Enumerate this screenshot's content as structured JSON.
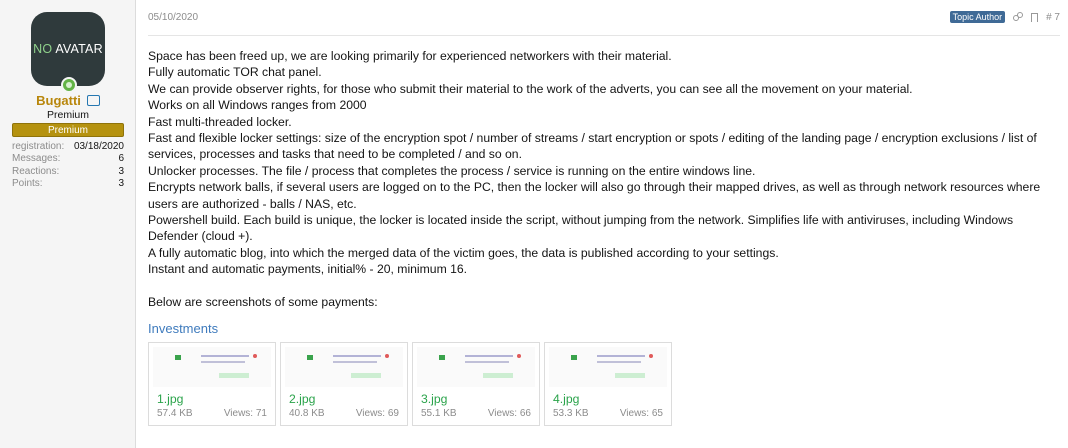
{
  "user": {
    "avatar_text": "NO AVATAR",
    "avatar_prefix": "NO",
    "avatar_suffix": "AVATAR",
    "name": "Bugatti",
    "title": "Premium",
    "banner": "Premium",
    "stats": [
      {
        "label": "registration:",
        "value": "03/18/2020"
      },
      {
        "label": "Messages:",
        "value": "6"
      },
      {
        "label": "Reactions:",
        "value": "3"
      },
      {
        "label": "Points:",
        "value": "3"
      }
    ]
  },
  "post": {
    "date": "05/10/2020",
    "author_badge": "Topic Author",
    "number": "# 7",
    "lines": [
      "Space has been freed up, we are looking primarily for experienced networkers with their material.",
      "Fully automatic TOR chat panel.",
      "We can provide observer rights, for those who submit their material to the work of the adverts, you can see all the movement on your material.",
      "Works on all Windows ranges from 2000",
      "Fast multi-threaded locker.",
      "Fast and flexible locker settings: size of the encryption spot / number of streams / start encryption or spots / editing of the landing page / encryption exclusions / list of services, processes and tasks that need to be completed / and so on.",
      "Unlocker processes. The file / process that completes the process / service is running on the entire windows line.",
      "Encrypts network balls, if several users are logged on to the PC, then the locker will also go through their mapped drives, as well as through network resources where users are authorized - balls / NAS, etc.",
      "Powershell build. Each build is unique, the locker is located inside the script, without jumping from the network. Simplifies life with antiviruses, including Windows Defender (cloud +).",
      "A fully automatic blog, into which the merged data of the victim goes, the data is published according to your settings.",
      "Instant and automatic payments, initial% - 20, minimum 16."
    ],
    "closing": "Below are screenshots of some payments:",
    "attachments_heading": "Investments",
    "attachments": [
      {
        "name": "1.jpg",
        "size": "57.4 KB",
        "views": "Views: 71"
      },
      {
        "name": "2.jpg",
        "size": "40.8 KB",
        "views": "Views: 69"
      },
      {
        "name": "3.jpg",
        "size": "55.1 KB",
        "views": "Views: 66"
      },
      {
        "name": "4.jpg",
        "size": "53.3 KB",
        "views": "Views: 65"
      }
    ]
  },
  "colors": {
    "username": "#b8860b",
    "banner": "#b5920f",
    "badge": "#3f6a96",
    "attachment_link": "#2aa34a",
    "heading": "#3f7bbd"
  }
}
